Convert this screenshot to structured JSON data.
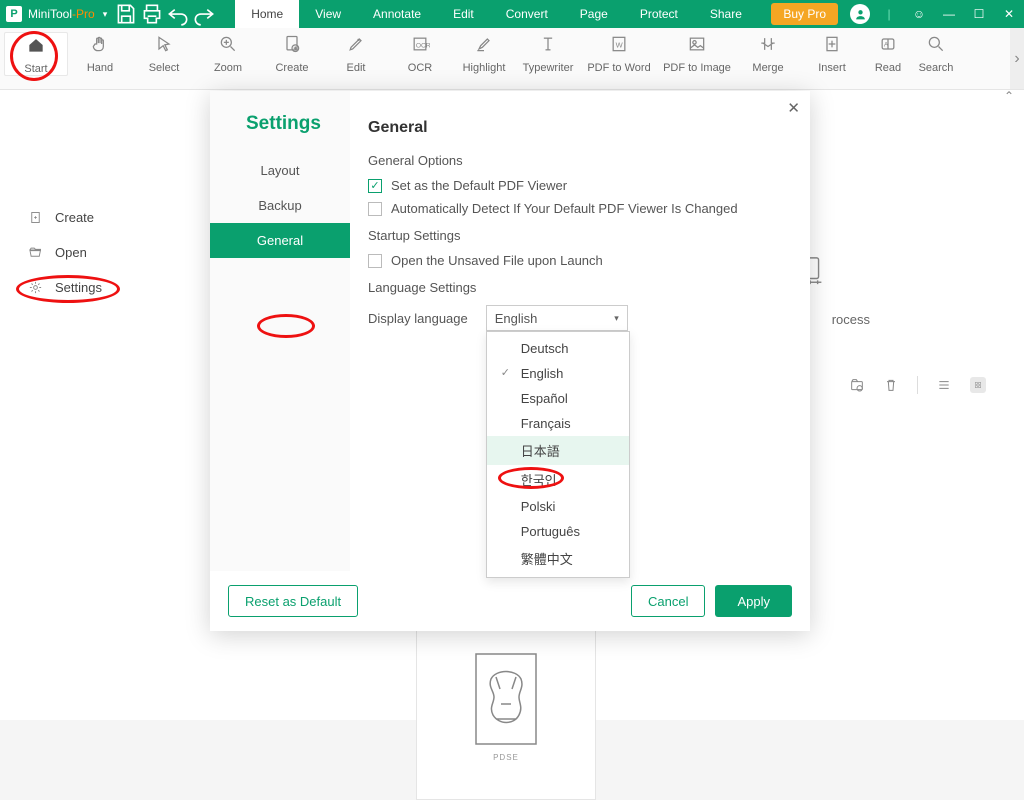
{
  "titlebar": {
    "app_name_main": "MiniTool",
    "app_name_suffix": "-Pro",
    "menus": [
      "Home",
      "View",
      "Annotate",
      "Edit",
      "Convert",
      "Page",
      "Protect",
      "Share"
    ],
    "active_menu_index": 0,
    "buy_label": "Buy Pro"
  },
  "ribbon": {
    "tools": [
      {
        "label": "Start",
        "icon": "home-icon"
      },
      {
        "label": "Hand",
        "icon": "hand-icon"
      },
      {
        "label": "Select",
        "icon": "cursor-icon"
      },
      {
        "label": "Zoom",
        "icon": "zoom-icon"
      },
      {
        "label": "Create",
        "icon": "create-icon"
      },
      {
        "label": "Edit",
        "icon": "edit-icon"
      },
      {
        "label": "OCR",
        "icon": "ocr-icon"
      },
      {
        "label": "Highlight",
        "icon": "highlight-icon"
      },
      {
        "label": "Typewriter",
        "icon": "typewriter-icon"
      },
      {
        "label": "PDF to Word",
        "icon": "pdf2word-icon"
      },
      {
        "label": "PDF to Image",
        "icon": "pdf2image-icon"
      },
      {
        "label": "Merge",
        "icon": "merge-icon"
      },
      {
        "label": "Insert",
        "icon": "insert-icon"
      },
      {
        "label": "Read",
        "icon": "read-icon"
      },
      {
        "label": "Search",
        "icon": "search-icon"
      }
    ]
  },
  "start_sidebar": {
    "items": [
      {
        "label": "Create",
        "icon": "file-plus-icon"
      },
      {
        "label": "Open",
        "icon": "folder-open-icon"
      },
      {
        "label": "Settings",
        "icon": "gear-icon"
      }
    ]
  },
  "main_ghost": {
    "process_text": "rocess",
    "thumb_caption": "PDSE"
  },
  "settings": {
    "dialog_title": "Settings",
    "tabs": [
      "Layout",
      "Backup",
      "General"
    ],
    "active_tab_index": 2,
    "heading": "General",
    "general_options_label": "General Options",
    "opt_default_viewer": "Set as the Default PDF Viewer",
    "opt_default_viewer_checked": true,
    "opt_autodetect": "Automatically Detect If Your Default PDF Viewer Is Changed",
    "opt_autodetect_checked": false,
    "startup_label": "Startup Settings",
    "opt_open_unsaved": "Open the Unsaved File upon Launch",
    "opt_open_unsaved_checked": false,
    "language_label": "Language Settings",
    "display_lang_label": "Display language",
    "display_lang_value": "English",
    "lang_options": [
      "Deutsch",
      "English",
      "Español",
      "Français",
      "日本語",
      "한국인",
      "Polski",
      "Português",
      "繁體中文"
    ],
    "lang_selected_index": 1,
    "lang_hover_index": 4,
    "reset_label": "Reset as Default",
    "cancel_label": "Cancel",
    "apply_label": "Apply"
  }
}
